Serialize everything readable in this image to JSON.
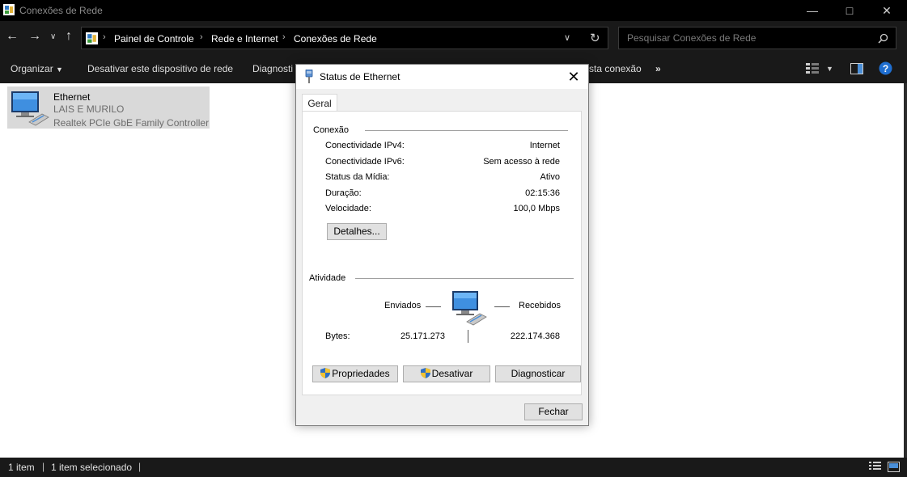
{
  "window": {
    "title": "Conexões de Rede",
    "icon": "control-panel-icon",
    "controls": [
      "minimize-icon",
      "maximize-icon",
      "close-icon"
    ]
  },
  "address_bar": {
    "breadcrumbs": [
      "Painel de Controle",
      "Rede e Internet",
      "Conexões de Rede"
    ],
    "search_placeholder": "Pesquisar Conexões de Rede"
  },
  "command_bar": {
    "organize": "Organizar",
    "disable_device": "Desativar este dispositivo de rede",
    "diagnose": "Diagnosti",
    "partial_right": "sta conexão",
    "more": "»"
  },
  "connection_item": {
    "name": "Ethernet",
    "network": "LAIS E MURILO",
    "adapter": "Realtek PCIe GbE Family Controller"
  },
  "status_bar": {
    "count": "1 item",
    "selected": "1 item selecionado"
  },
  "dialog": {
    "title": "Status de Ethernet",
    "tab": "Geral",
    "connection_heading": "Conexão",
    "rows": [
      {
        "label": "Conectividade IPv4:",
        "value": "Internet"
      },
      {
        "label": "Conectividade IPv6:",
        "value": "Sem acesso à rede"
      },
      {
        "label": "Status da Mídia:",
        "value": "Ativo"
      },
      {
        "label": "Duração:",
        "value": "02:15:36"
      },
      {
        "label": "Velocidade:",
        "value": "100,0 Mbps"
      }
    ],
    "details_button": "Detalhes...",
    "activity_heading": "Atividade",
    "sent_label": "Enviados",
    "received_label": "Recebidos",
    "bytes_label": "Bytes:",
    "bytes_sent": "25.171.273",
    "bytes_received": "222.174.368",
    "properties_button": "Propriedades",
    "disable_button": "Desativar",
    "diagnose_button": "Diagnosticar",
    "close_button": "Fechar"
  }
}
